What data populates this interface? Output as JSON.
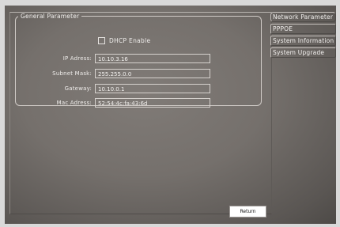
{
  "general": {
    "legend": "General Parameter",
    "dhcp_label": "DHCP Enable",
    "fields": [
      {
        "label": "IP Adress:",
        "value": "10.10.3.16"
      },
      {
        "label": "Subnet Mask:",
        "value": "255.255.0.0"
      },
      {
        "label": "Gateway:",
        "value": "10.10.0.1"
      },
      {
        "label": "Mac Adress:",
        "value": "52:54:4c:fa:43:6d"
      }
    ]
  },
  "sidebar": {
    "items": [
      {
        "label": "Network Parameter"
      },
      {
        "label": "PPPOE"
      },
      {
        "label": "System Information"
      },
      {
        "label": "System Upgrade"
      }
    ]
  },
  "footer": {
    "return_label": "Return"
  }
}
